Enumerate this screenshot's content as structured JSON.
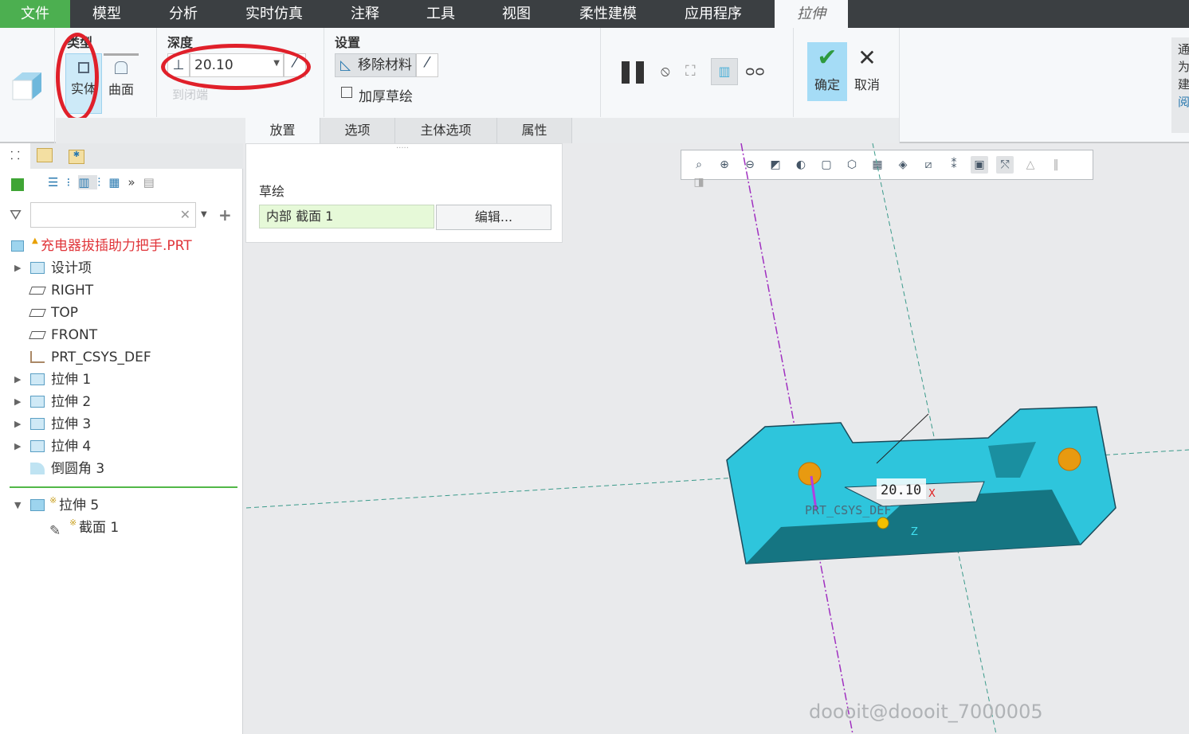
{
  "menubar": {
    "items": [
      "文件",
      "模型",
      "分析",
      "实时仿真",
      "注释",
      "工具",
      "视图",
      "柔性建模",
      "应用程序"
    ],
    "active_tab": "拉伸",
    "file_color": "#4caf50"
  },
  "ribbon": {
    "type_group": {
      "label": "类型",
      "solid": "实体",
      "surface": "曲面"
    },
    "depth_group": {
      "label": "深度",
      "value": "20.10",
      "to_closed": "到闭端"
    },
    "settings_group": {
      "label": "设置",
      "remove_material": "移除材料",
      "thicken_sketch": "加厚草绘"
    },
    "ok": "确定",
    "cancel": "取消",
    "side_hint": [
      "通",
      "为",
      "建",
      "阅"
    ]
  },
  "dashboard_tabs": [
    "放置",
    "选项",
    "主体选项",
    "属性"
  ],
  "placement_panel": {
    "sketch_label": "草绘",
    "sketch_value": "内部 截面 1",
    "edit_button": "编辑..."
  },
  "model_tree": {
    "root": "充电器拔插助力把手.PRT",
    "items": [
      {
        "label": "设计项",
        "expandable": true,
        "icon": "layer-icon"
      },
      {
        "label": "RIGHT",
        "expandable": false,
        "icon": "datum-plane-icon"
      },
      {
        "label": "TOP",
        "expandable": false,
        "icon": "datum-plane-icon"
      },
      {
        "label": "FRONT",
        "expandable": false,
        "icon": "datum-plane-icon"
      },
      {
        "label": "PRT_CSYS_DEF",
        "expandable": false,
        "icon": "csys-icon"
      },
      {
        "label": "拉伸 1",
        "expandable": true,
        "icon": "extrude-icon"
      },
      {
        "label": "拉伸 2",
        "expandable": true,
        "icon": "extrude-icon"
      },
      {
        "label": "拉伸 3",
        "expandable": true,
        "icon": "extrude-icon"
      },
      {
        "label": "拉伸 4",
        "expandable": true,
        "icon": "extrude-icon"
      },
      {
        "label": "倒圆角 3",
        "expandable": false,
        "icon": "round-icon"
      }
    ],
    "active": {
      "label": "拉伸 5",
      "child": "截面 1"
    }
  },
  "viewport": {
    "dimension": "20.10",
    "csys_label": "PRT_CSYS_DEF",
    "axis_x": "X",
    "axis_z": "Z",
    "model_color": "#2ec5dc",
    "watermark": "doooit@doooit_7000005"
  }
}
